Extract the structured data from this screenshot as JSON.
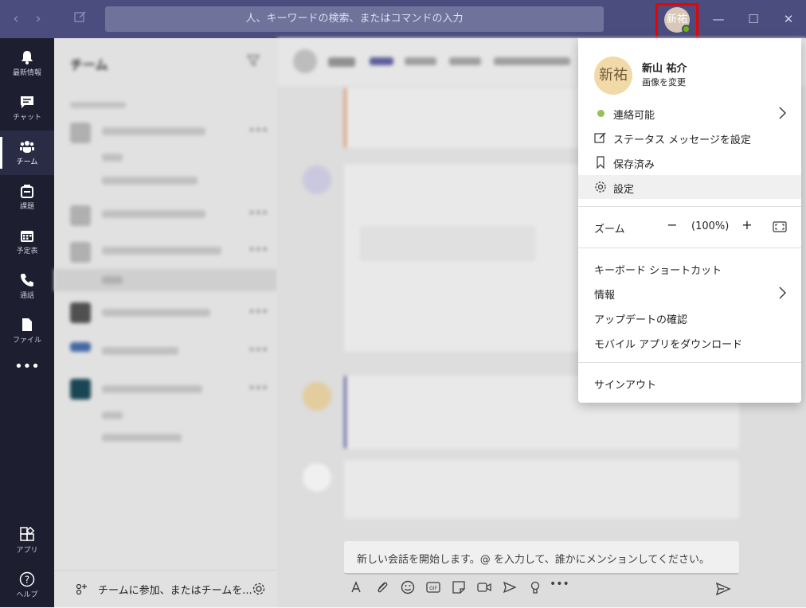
{
  "titlebar": {
    "search_placeholder": "人、キーワードの検索、またはコマンドの入力",
    "avatar_initials": "新祐"
  },
  "rail": {
    "items": [
      {
        "label": "最新情報",
        "icon": "bell-icon"
      },
      {
        "label": "チャット",
        "icon": "chat-icon"
      },
      {
        "label": "チーム",
        "icon": "teams-icon"
      },
      {
        "label": "課題",
        "icon": "assignments-icon"
      },
      {
        "label": "予定表",
        "icon": "calendar-icon"
      },
      {
        "label": "通話",
        "icon": "phone-icon"
      },
      {
        "label": "ファイル",
        "icon": "file-icon"
      },
      {
        "label": "アプリ",
        "icon": "apps-icon"
      },
      {
        "label": "ヘルプ",
        "icon": "help-icon"
      }
    ]
  },
  "teams_pane": {
    "title": "チーム",
    "join_label": "チームに参加、またはチームを..."
  },
  "composer": {
    "placeholder": "新しい会話を開始します。@ を入力して、誰かにメンションしてください。"
  },
  "menu": {
    "profile": {
      "initials": "新祐",
      "name": "新山 祐介",
      "change_picture": "画像を変更"
    },
    "status": "連絡可能",
    "set_status": "ステータス メッセージを設定",
    "saved": "保存済み",
    "settings": "設定",
    "zoom": {
      "label": "ズーム",
      "minus": "−",
      "value": "(100%)",
      "plus": "+"
    },
    "shortcuts": "キーボード ショートカット",
    "about": "情報",
    "check_updates": "アップデートの確認",
    "download_mobile": "モバイル アプリをダウンロード",
    "sign_out": "サインアウト"
  },
  "colors": {
    "titlebar": "#4b4d7e",
    "rail": "#1d1e2f",
    "available": "#92c353",
    "highlight": "#ee0000"
  }
}
